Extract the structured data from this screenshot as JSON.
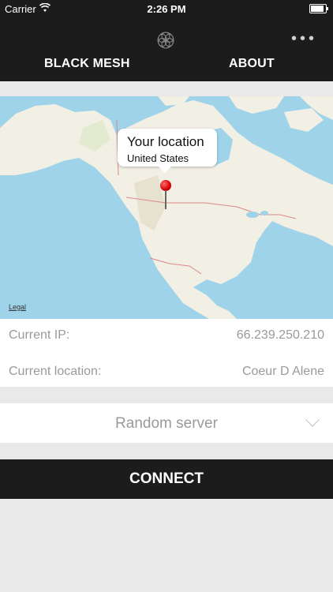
{
  "status_bar": {
    "carrier": "Carrier",
    "time": "2:26 PM"
  },
  "header": {
    "logo_icon": "mesh-flower-icon",
    "menu_icon": "more-dots-icon",
    "tabs": [
      {
        "label": "BLACK MESH"
      },
      {
        "label": "ABOUT"
      }
    ]
  },
  "map": {
    "callout": {
      "title": "Your location",
      "subtitle": "United States"
    },
    "legal": "Legal"
  },
  "info": {
    "ip_label": "Current IP:",
    "ip_value": "66.239.250.210",
    "location_label": "Current location:",
    "location_value": "Coeur D Alene"
  },
  "server": {
    "selected": "Random server"
  },
  "actions": {
    "connect_label": "CONNECT"
  },
  "colors": {
    "header_bg": "#1c1c1c",
    "page_bg": "#e9e9e9",
    "water": "#9fd3ea",
    "land": "#f2efe4",
    "pin": "#d40000"
  }
}
